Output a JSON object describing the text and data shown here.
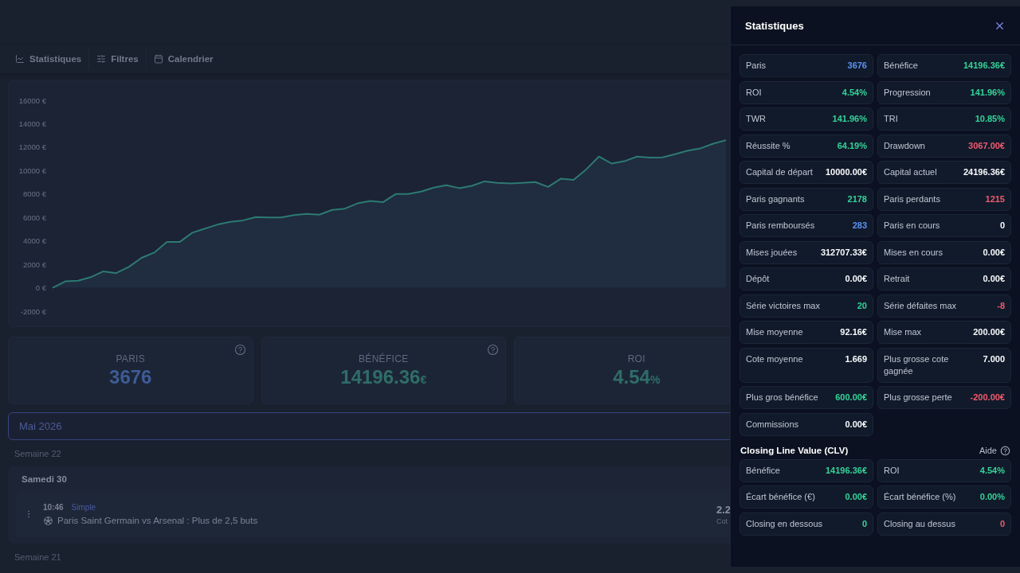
{
  "toolbar": {
    "items": [
      {
        "label": "Statistiques"
      },
      {
        "label": "Filtres"
      },
      {
        "label": "Calendrier"
      }
    ]
  },
  "equity_chart": {
    "chart_data": {
      "type": "area",
      "categories": [
        null,
        null,
        null,
        null,
        null,
        null,
        null,
        null,
        null,
        null,
        null,
        null,
        null,
        null,
        null,
        null,
        null,
        null,
        null,
        null,
        null,
        null,
        null,
        null,
        null,
        null,
        null,
        null,
        null,
        null,
        null,
        null,
        null,
        null,
        null,
        null,
        null,
        null,
        null,
        null,
        null,
        null,
        null,
        null,
        null,
        null,
        null,
        null,
        null,
        null,
        null,
        null,
        null,
        null
      ],
      "ylim": [
        -2000,
        16000
      ],
      "yticks": [
        {
          "value": 16000,
          "label": "16000 €"
        },
        {
          "value": 14000,
          "label": "14000 €"
        },
        {
          "value": 12000,
          "label": "12000 €"
        },
        {
          "value": 10000,
          "label": "10000 €"
        },
        {
          "value": 8000,
          "label": "8000 €"
        },
        {
          "value": 6000,
          "label": "6000 €"
        },
        {
          "value": 4000,
          "label": "4000 €"
        },
        {
          "value": 2000,
          "label": "2000 €"
        },
        {
          "value": 0,
          "label": "0 €"
        },
        {
          "value": -2000,
          "label": "-2000 €"
        }
      ],
      "series": [
        {
          "color": "#2d7a72",
          "values": [
            0,
            540,
            600,
            900,
            1400,
            1250,
            1780,
            2550,
            3000,
            3900,
            3900,
            4700,
            5050,
            5400,
            5630,
            5750,
            6030,
            6000,
            6000,
            6200,
            6300,
            6240,
            6640,
            6750,
            7200,
            7400,
            7300,
            8000,
            8000,
            8200,
            8550,
            8750,
            8500,
            8700,
            9080,
            8950,
            8900,
            8950,
            9020,
            8600,
            9300,
            9200,
            10100,
            11200,
            10600,
            10800,
            11200,
            11100,
            11120,
            11400,
            11700,
            11900,
            12300,
            12600
          ]
        }
      ]
    }
  },
  "summary_cards": [
    {
      "label": "PARIS",
      "value": "3676",
      "color": "#3e5b94",
      "help": true
    },
    {
      "label": "BÉNÉFICE",
      "value": "14196.36",
      "unit": "€",
      "color": "#2f6d67",
      "help": true
    },
    {
      "label": "ROI",
      "value": "4.54",
      "unit": "%",
      "color": "#2f6d67",
      "help": false
    }
  ],
  "month_field": {
    "value": "Mai 2026"
  },
  "weeks": [
    {
      "label": "Semaine 22",
      "days": [
        {
          "label": "Samedi 30",
          "bets": [
            {
              "time": "10:46",
              "type": "Simple",
              "event": "Paris Saint Germain vs Arsenal : Plus de 2,5 buts",
              "odds": "2.2",
              "odds_label": "Cot"
            }
          ]
        }
      ]
    },
    {
      "label": "Semaine 21"
    }
  ],
  "stats_panel": {
    "title": "Statistiques",
    "stats": [
      {
        "label": "Paris",
        "value": "3676",
        "color": "#5b93f5"
      },
      {
        "label": "Bénéfice",
        "value": "14196.36€",
        "color": "#34d399"
      },
      {
        "label": "ROI",
        "value": "4.54%",
        "color": "#34d399"
      },
      {
        "label": "Progression",
        "value": "141.96%",
        "color": "#34d399"
      },
      {
        "label": "TWR",
        "value": "141.96%",
        "color": "#34d399"
      },
      {
        "label": "TRI",
        "value": "10.85%",
        "color": "#34d399"
      },
      {
        "label": "Réussite %",
        "value": "64.19%",
        "color": "#34d399"
      },
      {
        "label": "Drawdown",
        "value": "3067.00€",
        "color": "#f05a6e"
      },
      {
        "label": "Capital de départ",
        "value": "10000.00€",
        "color": "#f8fafc"
      },
      {
        "label": "Capital actuel",
        "value": "24196.36€",
        "color": "#f8fafc"
      },
      {
        "label": "Paris gagnants",
        "value": "2178",
        "color": "#34d399"
      },
      {
        "label": "Paris perdants",
        "value": "1215",
        "color": "#f05a6e"
      },
      {
        "label": "Paris remboursés",
        "value": "283",
        "color": "#5b93f5"
      },
      {
        "label": "Paris en cours",
        "value": "0",
        "color": "#f8fafc"
      },
      {
        "label": "Mises jouées",
        "value": "312707.33€",
        "color": "#f8fafc"
      },
      {
        "label": "Mises en cours",
        "value": "0.00€",
        "color": "#f8fafc"
      },
      {
        "label": "Dépôt",
        "value": "0.00€",
        "color": "#f8fafc"
      },
      {
        "label": "Retrait",
        "value": "0.00€",
        "color": "#f8fafc"
      },
      {
        "label": "Série victoires max",
        "value": "20",
        "color": "#34d399"
      },
      {
        "label": "Série défaites max",
        "value": "-8",
        "color": "#f05a6e"
      },
      {
        "label": "Mise moyenne",
        "value": "92.16€",
        "color": "#f8fafc"
      },
      {
        "label": "Mise max",
        "value": "200.00€",
        "color": "#f8fafc"
      },
      {
        "label": "Cote moyenne",
        "value": "1.669",
        "color": "#f8fafc"
      },
      {
        "label": "Plus grosse cote gagnée",
        "value": "7.000",
        "color": "#f8fafc"
      },
      {
        "label": "Plus gros bénéfice",
        "value": "600.00€",
        "color": "#34d399"
      },
      {
        "label": "Plus grosse perte",
        "value": "-200.00€",
        "color": "#f05a6e"
      },
      {
        "label": "Commissions",
        "value": "0.00€",
        "color": "#f8fafc"
      }
    ],
    "clv": {
      "title": "Closing Line Value (CLV)",
      "help_label": "Aide",
      "stats": [
        {
          "label": "Bénéfice",
          "value": "14196.36€",
          "color": "#34d399"
        },
        {
          "label": "ROI",
          "value": "4.54%",
          "color": "#34d399"
        },
        {
          "label": "Écart bénéfice (€)",
          "value": "0.00€",
          "color": "#34d399"
        },
        {
          "label": "Écart bénéfice (%)",
          "value": "0.00%",
          "color": "#34d399"
        },
        {
          "label": "Closing en dessous",
          "value": "0",
          "color": "#34d399"
        },
        {
          "label": "Closing au dessus",
          "value": "0",
          "color": "#f05a6e"
        }
      ]
    }
  }
}
